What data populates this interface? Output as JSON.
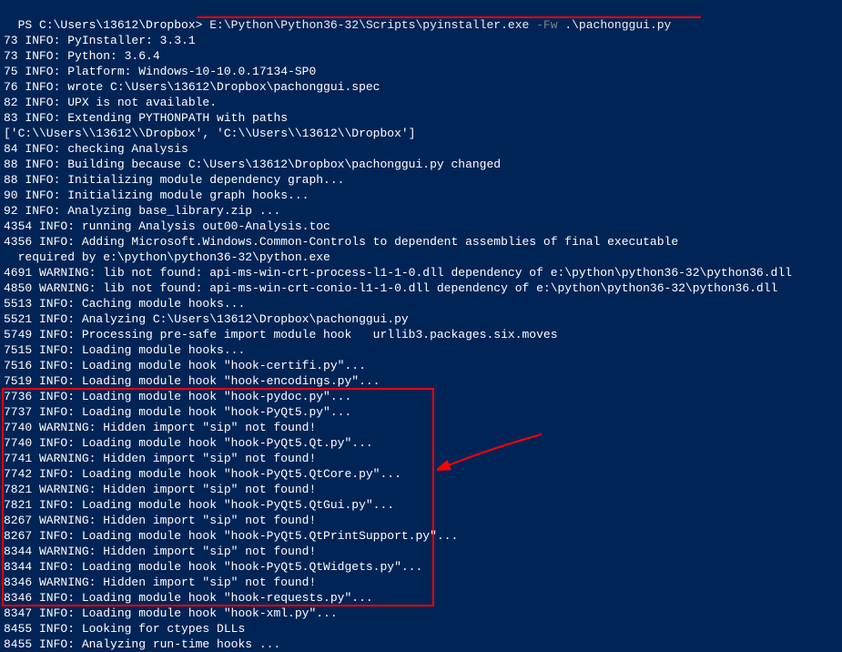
{
  "prompt": {
    "prefix": "PS C:\\Users\\13612\\Dropbox> ",
    "command": "E:\\Python\\Python36-32\\Scripts\\pyinstaller.exe",
    "flag": " -Fw ",
    "arg": ".\\pachonggui.py"
  },
  "lines": [
    "73 INFO: PyInstaller: 3.3.1",
    "73 INFO: Python: 3.6.4",
    "75 INFO: Platform: Windows-10-10.0.17134-SP0",
    "76 INFO: wrote C:\\Users\\13612\\Dropbox\\pachonggui.spec",
    "82 INFO: UPX is not available.",
    "83 INFO: Extending PYTHONPATH with paths",
    "['C:\\\\Users\\\\13612\\\\Dropbox', 'C:\\\\Users\\\\13612\\\\Dropbox']",
    "84 INFO: checking Analysis",
    "88 INFO: Building because C:\\Users\\13612\\Dropbox\\pachonggui.py changed",
    "88 INFO: Initializing module dependency graph...",
    "90 INFO: Initializing module graph hooks...",
    "92 INFO: Analyzing base_library.zip ...",
    "4354 INFO: running Analysis out00-Analysis.toc",
    "4356 INFO: Adding Microsoft.Windows.Common-Controls to dependent assemblies of final executable",
    "  required by e:\\python\\python36-32\\python.exe",
    "4691 WARNING: lib not found: api-ms-win-crt-process-l1-1-0.dll dependency of e:\\python\\python36-32\\python36.dll",
    "4850 WARNING: lib not found: api-ms-win-crt-conio-l1-1-0.dll dependency of e:\\python\\python36-32\\python36.dll",
    "5513 INFO: Caching module hooks...",
    "5521 INFO: Analyzing C:\\Users\\13612\\Dropbox\\pachonggui.py",
    "5749 INFO: Processing pre-safe import module hook   urllib3.packages.six.moves",
    "7515 INFO: Loading module hooks...",
    "7516 INFO: Loading module hook \"hook-certifi.py\"...",
    "7519 INFO: Loading module hook \"hook-encodings.py\"...",
    "7736 INFO: Loading module hook \"hook-pydoc.py\"...",
    "7737 INFO: Loading module hook \"hook-PyQt5.py\"...",
    "7740 WARNING: Hidden import \"sip\" not found!",
    "7740 INFO: Loading module hook \"hook-PyQt5.Qt.py\"...",
    "7741 WARNING: Hidden import \"sip\" not found!",
    "7742 INFO: Loading module hook \"hook-PyQt5.QtCore.py\"...",
    "7821 WARNING: Hidden import \"sip\" not found!",
    "7821 INFO: Loading module hook \"hook-PyQt5.QtGui.py\"...",
    "8267 WARNING: Hidden import \"sip\" not found!",
    "8267 INFO: Loading module hook \"hook-PyQt5.QtPrintSupport.py\"...",
    "8344 WARNING: Hidden import \"sip\" not found!",
    "8344 INFO: Loading module hook \"hook-PyQt5.QtWidgets.py\"...",
    "8346 WARNING: Hidden import \"sip\" not found!",
    "8346 INFO: Loading module hook \"hook-requests.py\"...",
    "8347 INFO: Loading module hook \"hook-xml.py\"...",
    "8455 INFO: Looking for ctypes DLLs",
    "8455 INFO: Analyzing run-time hooks ..."
  ],
  "annotations": {
    "underline_color": "#ff0000",
    "box_color": "#ff0000",
    "arrow_color": "#ff0000"
  }
}
